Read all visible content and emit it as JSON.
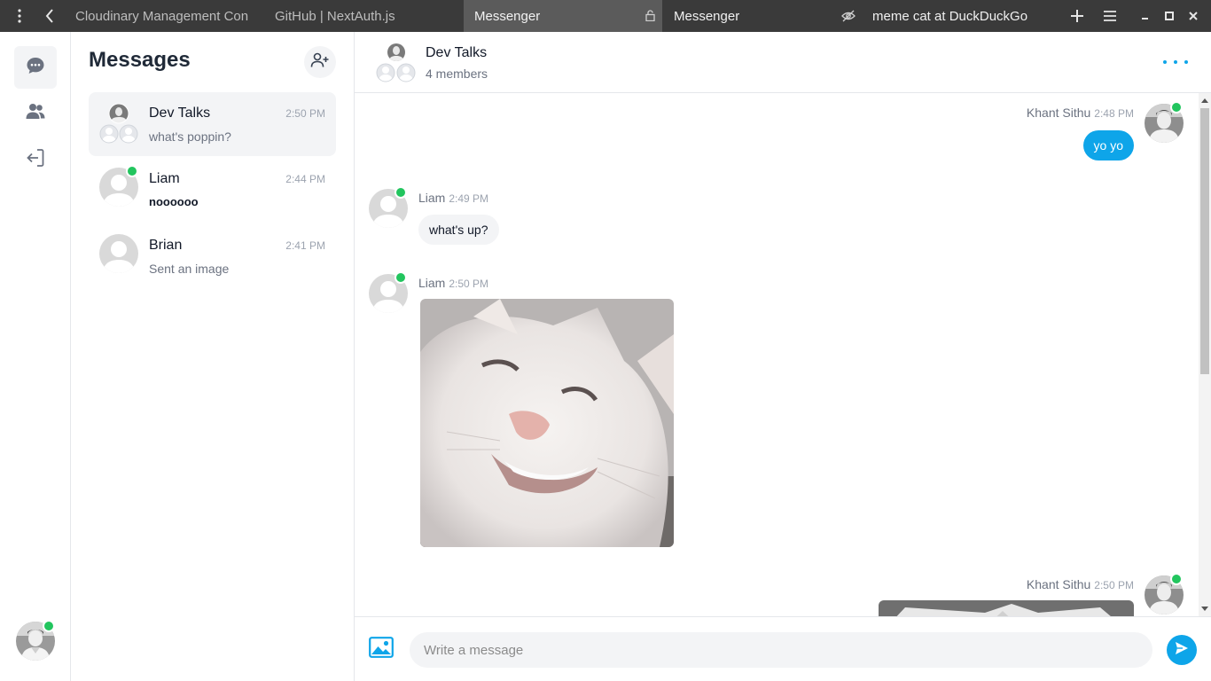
{
  "browser": {
    "tabs": [
      {
        "label": "Cloudinary Management Con"
      },
      {
        "label": "GitHub | NextAuth.js"
      },
      {
        "label": "Messenger"
      },
      {
        "label": "Messenger"
      },
      {
        "label": "meme cat at DuckDuckGo"
      }
    ]
  },
  "sidebar": {
    "title": "Messages",
    "conversations": [
      {
        "name": "Dev Talks",
        "time": "2:50 PM",
        "preview": "what's poppin?"
      },
      {
        "name": "Liam",
        "time": "2:44 PM",
        "preview": "noooooo"
      },
      {
        "name": "Brian",
        "time": "2:41 PM",
        "preview": "Sent an image"
      }
    ]
  },
  "chat": {
    "title": "Dev Talks",
    "subtitle": "4 members",
    "messages": [
      {
        "sender": "Khant Sithu",
        "time": "2:48 PM",
        "text": "yo yo"
      },
      {
        "sender": "Liam",
        "time": "2:49 PM",
        "text": "what's up?"
      },
      {
        "sender": "Liam",
        "time": "2:50 PM",
        "image": "white-cat-smiling-meme"
      },
      {
        "sender": "Khant Sithu",
        "time": "2:50 PM",
        "image": "cat-image"
      }
    ],
    "composer": {
      "placeholder": "Write a message"
    }
  },
  "colors": {
    "accent": "#0ea5e9",
    "online": "#22c55e",
    "topbar": "#3a3a3a"
  }
}
